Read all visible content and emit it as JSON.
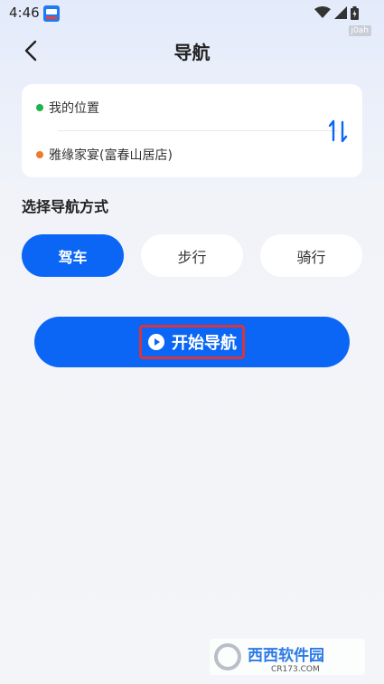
{
  "status_bar": {
    "time": "4:46",
    "tag": "j0ah"
  },
  "header": {
    "title": "导航"
  },
  "route": {
    "start": "我的位置",
    "end": "雅缘家宴(富春山居店)"
  },
  "section_title": "选择导航方式",
  "modes": [
    {
      "label": "驾车",
      "selected": true
    },
    {
      "label": "步行",
      "selected": false
    },
    {
      "label": "骑行",
      "selected": false
    }
  ],
  "start_button": {
    "label": "开始导航"
  },
  "watermark": {
    "title": "西西软件园",
    "url": "CR173.COM"
  },
  "colors": {
    "accent": "#0b66f5",
    "start_dot": "#1fb24a",
    "end_dot": "#f07a2a",
    "highlight": "#d9343d"
  }
}
